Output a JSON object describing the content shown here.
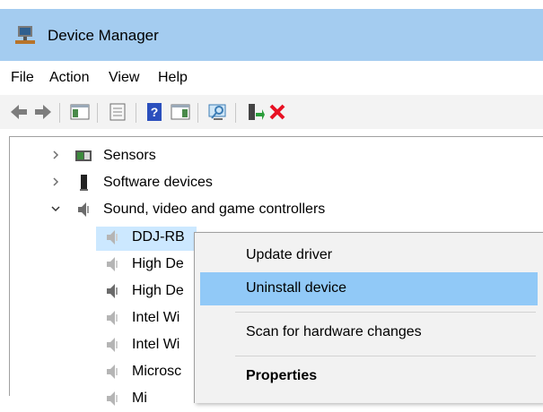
{
  "window": {
    "title": "Device Manager"
  },
  "menu": [
    "File",
    "Action",
    "View",
    "Help"
  ],
  "toolbar": {
    "buttons": [
      "back-arrow-icon",
      "forward-arrow-icon",
      "show-hide-console-tree-icon",
      "properties-icon",
      "help-icon",
      "action-pane-icon",
      "scan-hardware-icon",
      "enable-device-icon",
      "uninstall-x-icon"
    ],
    "colors": {
      "uninstall": "#e81123",
      "enable": "#2a9d3a",
      "help": "#2b4fbd"
    }
  },
  "tree": {
    "rows": [
      {
        "label": "Sensors",
        "expanded": false,
        "icon": "sensor-icon"
      },
      {
        "label": "Software devices",
        "expanded": false,
        "icon": "software-device-icon"
      },
      {
        "label": "Sound, video and game controllers",
        "expanded": true,
        "icon": "speaker-icon"
      },
      {
        "label": "DDJ-RB",
        "selected": true,
        "icon": "speaker-icon"
      },
      {
        "label": "High De",
        "icon": "speaker-icon"
      },
      {
        "label": "High De",
        "icon": "speaker-icon"
      },
      {
        "label": "Intel Wi",
        "icon": "speaker-icon"
      },
      {
        "label": "Intel Wi",
        "icon": "speaker-icon"
      },
      {
        "label": "Microsc",
        "icon": "speaker-icon"
      },
      {
        "label": "Mi",
        "icon": "speaker-icon"
      }
    ]
  },
  "context_menu": {
    "items": [
      "Update driver",
      "Uninstall device",
      "Scan for hardware changes",
      "Properties"
    ],
    "highlighted": "Uninstall device",
    "highlight_color": "#91c9f7",
    "selection_color": "#cce8ff"
  }
}
